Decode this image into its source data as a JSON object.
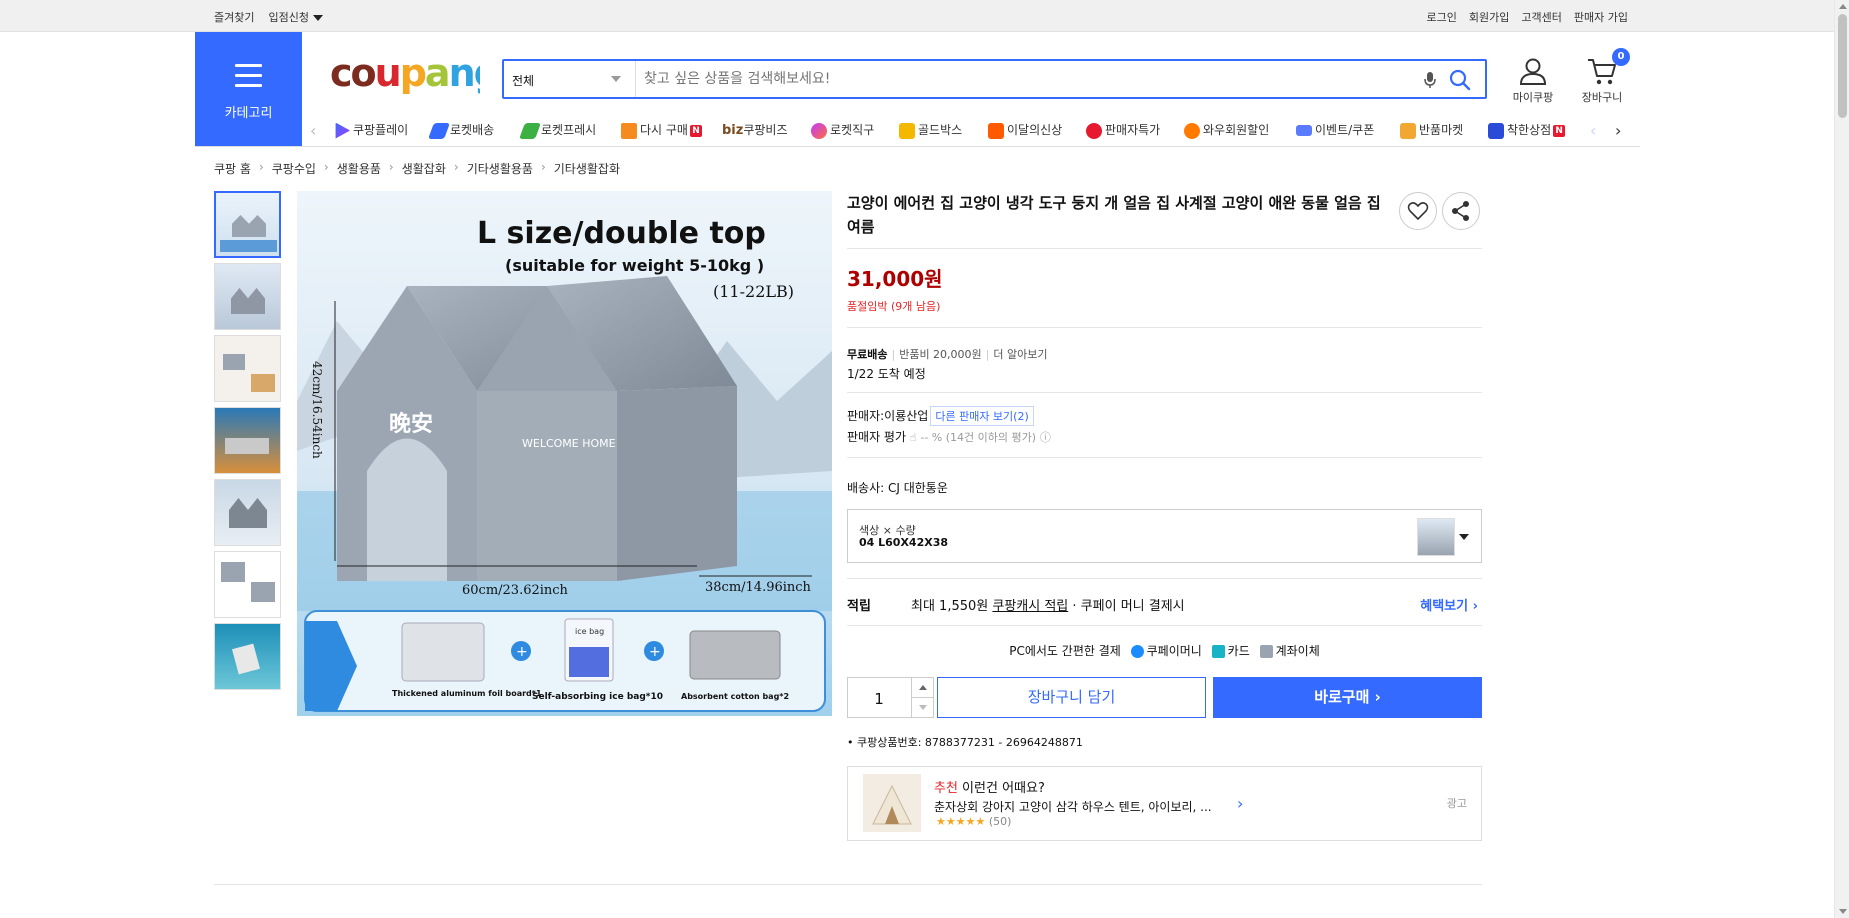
{
  "topbar": {
    "left": [
      "즐겨찾기",
      "입점신청"
    ],
    "right": [
      "로그인",
      "회원가입",
      "고객센터",
      "판매자 가입"
    ]
  },
  "header": {
    "category_label": "카테고리",
    "logo": "coupang",
    "search_scope": "전체",
    "search_placeholder": "찾고 싶은 상품을 검색해보세요!",
    "mycoupang_label": "마이쿠팡",
    "cart_label": "장바구니",
    "cart_count": "0"
  },
  "nav": {
    "items": [
      "쿠팡플레이",
      "로켓배송",
      "로켓프레시",
      "다시 구매",
      "쿠팡비즈",
      "로켓직구",
      "골드박스",
      "이달의신상",
      "판매자특가",
      "와우회원할인",
      "이벤트/쿠폰",
      "반품마켓",
      "착한상점"
    ],
    "biz_prefix": "biz",
    "new_badge": "N"
  },
  "breadcrumb": [
    "쿠팡 홈",
    "쿠팡수입",
    "생활용품",
    "생활잡화",
    "기타생활용품",
    "기타생활잡화"
  ],
  "image": {
    "headline": "L size/double top",
    "subline": "(suitable for weight 5-10kg )",
    "weight_lb": "(11-22LB)",
    "height_label": "42cm/16.54inch",
    "width_label": "60cm/23.62inch",
    "depth_label": "38cm/14.96inch",
    "house_text": "WELCOME HOME",
    "door_text": "晚安",
    "items": [
      "Thickened aluminum foil board*1",
      "Self-absorbing ice bag*10",
      "Absorbent cotton bag*2"
    ],
    "ice_bag_text": "ice bag"
  },
  "product": {
    "title": "고양이 에어컨 집 고양이 냉각 도구 둥지 개 얼음 집 사계절 고양이 애완 동물 얼음 집 여름",
    "price": "31,000원",
    "stock": "품절임박 (9개 남음)",
    "free_shipping": "무료배송",
    "return_fee": "반품비 20,000원",
    "more": "더 알아보기",
    "arrival": "1/22 도착 예정",
    "seller_prefix": "판매자:",
    "seller_name": "이룡산업",
    "other_sellers": "다른 판매자 보기(2)",
    "seller_rating_label": "판매자 평가",
    "seller_rating_value": "-- % (14건 이하의 평가)",
    "carrier": "배송사:  CJ 대한통운",
    "option_label": "색상 × 수량",
    "option_value": "04 L60X42X38",
    "points_label": "적립",
    "points_text_1": "최대 1,550원 ",
    "points_link": "쿠팡캐시 적립",
    "points_text_2": " · 쿠페이 머니 결제시",
    "benefit": "혜택보기 ›",
    "pc_pay_label": "PC에서도 간편한 결제",
    "pay_methods": [
      "쿠페이머니",
      "카드",
      "계좌이체"
    ],
    "quantity": "1",
    "add_to_cart": "장바구니 담기",
    "buy_now": "바로구매 ›",
    "product_id": "쿠팡상품번호: 8788377231 - 26964248871"
  },
  "recommend": {
    "title_red": "추천",
    "title_rest": " 이런건 어때요?",
    "desc": "춘자상회 강아지 고양이 삼각 하우스 텐트, 아이보리, ...",
    "rating": "★★★★★",
    "rating_count": "(50)",
    "ad_label": "광고"
  },
  "colors": {
    "accent": "#346aff",
    "price_red": "#ae0000"
  }
}
